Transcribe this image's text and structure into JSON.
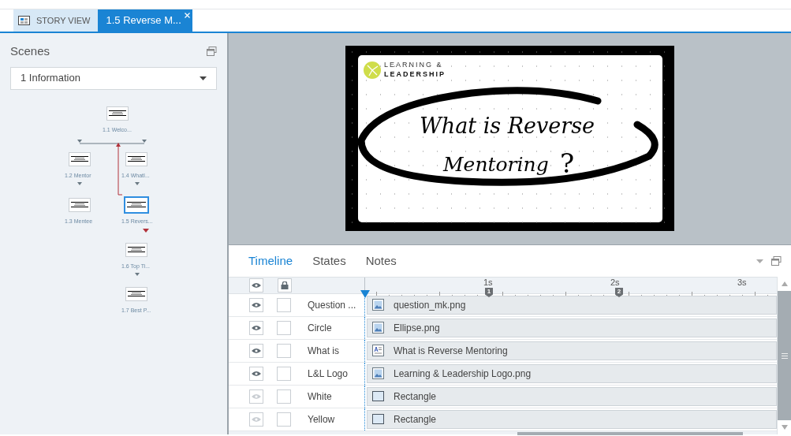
{
  "document_tabs": [
    {
      "label": "STORY VIEW",
      "kind": "story",
      "selected": false
    },
    {
      "label": "1.5 Reverse M...",
      "kind": "slide",
      "selected": true
    }
  ],
  "scenes_panel": {
    "title": "Scenes",
    "scene_dropdown": "1 Information",
    "nodes": [
      {
        "label": "1.1 Welco...",
        "selected": false
      },
      {
        "label": "1.2 Mentor",
        "selected": false
      },
      {
        "label": "1.4 WhatI...",
        "selected": false
      },
      {
        "label": "1.3 Mentee",
        "selected": false
      },
      {
        "label": "1.5 Revers...",
        "selected": true
      },
      {
        "label": "1.6 Top Ti...",
        "selected": false
      },
      {
        "label": "1.7 Best P...",
        "selected": false
      }
    ]
  },
  "slide": {
    "logo_line_1": "LEARNING &",
    "logo_line_2": "LEADERSHIP",
    "heading_line_1": "What is Reverse",
    "heading_line_2": "Mentoring",
    "question_mark": "?"
  },
  "panel_tabs": [
    {
      "label": "Timeline",
      "selected": true
    },
    {
      "label": "States",
      "selected": false
    },
    {
      "label": "Notes",
      "selected": false
    }
  ],
  "ruler": {
    "ticks": [
      "1s",
      "2s",
      "3s"
    ],
    "cue_points": [
      "1",
      "2"
    ]
  },
  "layers": [
    {
      "name": "Question ...",
      "object": "question_mk.png",
      "kind": "image",
      "visible": true,
      "locked": false
    },
    {
      "name": "Circle",
      "object": "Ellipse.png",
      "kind": "image",
      "visible": true,
      "locked": false
    },
    {
      "name": "What is",
      "object": "What is Reverse Mentoring",
      "kind": "text",
      "visible": true,
      "locked": false
    },
    {
      "name": "L&L Logo",
      "object": "Learning & Leadership Logo.png",
      "kind": "image",
      "visible": true,
      "locked": false
    },
    {
      "name": "White",
      "object": "Rectangle",
      "kind": "shape",
      "visible": false,
      "locked": false
    },
    {
      "name": "Yellow",
      "object": "Rectangle",
      "kind": "shape",
      "visible": false,
      "locked": false
    }
  ]
}
